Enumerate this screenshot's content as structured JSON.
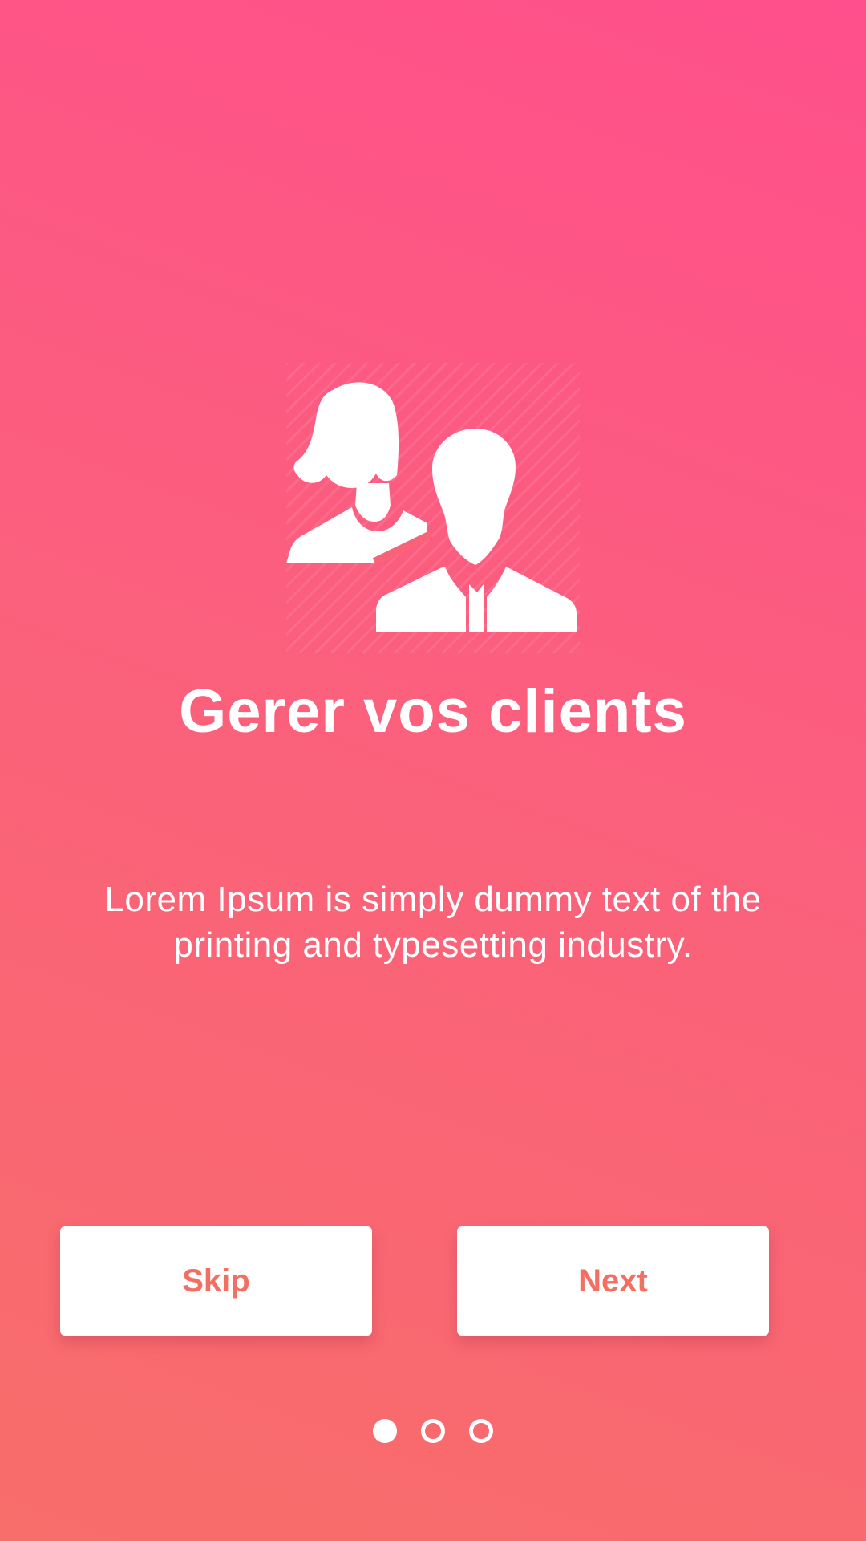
{
  "onboarding": {
    "illustration_icon": "clients-people-icon",
    "title": "Gerer vos clients",
    "description": "Lorem Ipsum is simply dummy text of the printing and typesetting industry.",
    "skip_label": "Skip",
    "next_label": "Next",
    "page_indicator": {
      "total_pages": 3,
      "current_page": 1
    }
  },
  "colors": {
    "background_top": "#ff4f8c",
    "background_bottom": "#f86e6a",
    "button_text": "#f26f62",
    "foreground": "#ffffff"
  }
}
